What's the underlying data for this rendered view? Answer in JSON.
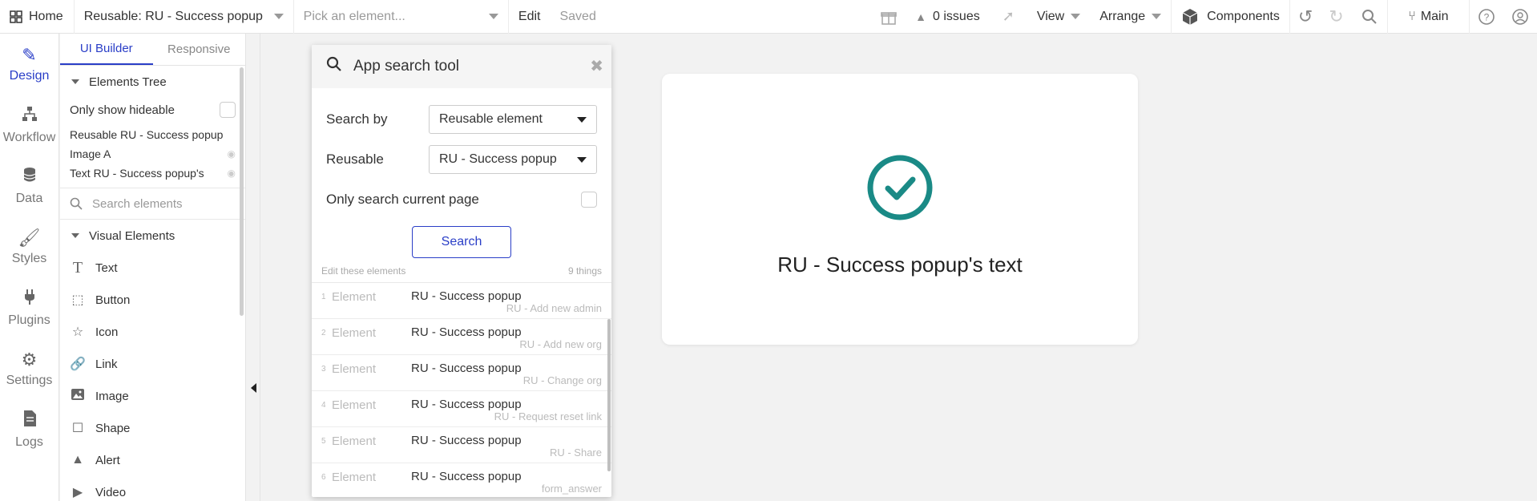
{
  "topbar": {
    "home_label": "Home",
    "page_select": "Reusable: RU - Success popup",
    "element_picker_placeholder": "Pick an element...",
    "edit_label": "Edit",
    "saved_label": "Saved",
    "issues_label": "0 issues",
    "view_label": "View",
    "arrange_label": "Arrange",
    "components_label": "Components",
    "branch_label": "Main"
  },
  "leftnav": {
    "items": [
      {
        "label": "Design",
        "icon": "pencil-ruler-icon"
      },
      {
        "label": "Workflow",
        "icon": "workflow-icon"
      },
      {
        "label": "Data",
        "icon": "database-icon"
      },
      {
        "label": "Styles",
        "icon": "brush-icon"
      },
      {
        "label": "Plugins",
        "icon": "plug-icon"
      },
      {
        "label": "Settings",
        "icon": "gear-icon"
      },
      {
        "label": "Logs",
        "icon": "document-icon"
      }
    ]
  },
  "panel": {
    "tabs": [
      "UI Builder",
      "Responsive"
    ],
    "elements_tree_label": "Elements Tree",
    "only_show_hideable_label": "Only show hideable",
    "tree_items": [
      "Reusable RU - Success popup",
      "Image A",
      "Text RU - Success popup's"
    ],
    "search_placeholder": "Search elements",
    "visual_elements_label": "Visual Elements",
    "visual_elements": [
      {
        "label": "Text",
        "icon": "text-icon"
      },
      {
        "label": "Button",
        "icon": "button-icon"
      },
      {
        "label": "Icon",
        "icon": "star-icon"
      },
      {
        "label": "Link",
        "icon": "link-icon"
      },
      {
        "label": "Image",
        "icon": "image-icon"
      },
      {
        "label": "Shape",
        "icon": "shape-icon"
      },
      {
        "label": "Alert",
        "icon": "alert-icon"
      },
      {
        "label": "Video",
        "icon": "video-icon"
      }
    ]
  },
  "search_tool": {
    "title": "App search tool",
    "search_by_label": "Search by",
    "search_by_value": "Reusable element",
    "reusable_label": "Reusable",
    "reusable_value": "RU - Success popup",
    "only_current_page_label": "Only search current page",
    "search_button": "Search",
    "edit_hint": "Edit these elements",
    "count_label": "9 things",
    "results": [
      {
        "num": "1",
        "type": "Element",
        "name": "RU - Success popup",
        "sub": "RU - Add new admin"
      },
      {
        "num": "2",
        "type": "Element",
        "name": "RU - Success popup",
        "sub": "RU - Add new org"
      },
      {
        "num": "3",
        "type": "Element",
        "name": "RU - Success popup",
        "sub": "RU - Change org"
      },
      {
        "num": "4",
        "type": "Element",
        "name": "RU - Success popup",
        "sub": "RU - Request reset link"
      },
      {
        "num": "5",
        "type": "Element",
        "name": "RU - Success popup",
        "sub": "RU - Share"
      },
      {
        "num": "6",
        "type": "Element",
        "name": "RU - Success popup",
        "sub": "form_answer"
      }
    ]
  },
  "preview": {
    "text": "RU - Success popup's text",
    "accent_color": "#1a8a86"
  }
}
